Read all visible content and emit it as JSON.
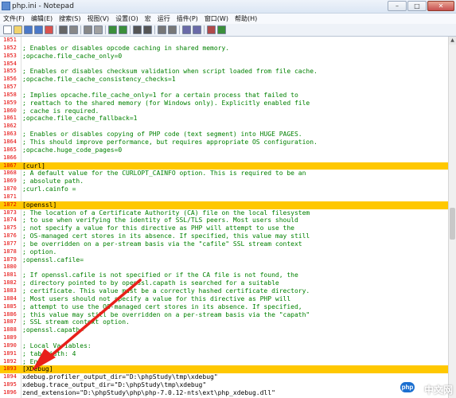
{
  "window": {
    "title": "php.ini - Notepad"
  },
  "menu": [
    "文件(F)",
    "编辑(E)",
    "搜索(S)",
    "视图(V)",
    "设置(O)",
    "宏",
    "运行",
    "插件(P)",
    "窗口(W)",
    "帮助(H)"
  ],
  "toolbar_icons": [
    "new-file-icon",
    "open-file-icon",
    "save-icon",
    "save-all-icon",
    "close-file-icon",
    "print-icon",
    "cut-icon",
    "copy-icon",
    "paste-icon",
    "undo-icon",
    "redo-icon",
    "find-icon",
    "replace-icon",
    "zoom-in-icon",
    "zoom-out-icon",
    "word-wrap-icon",
    "indent-icon",
    "macro-icon",
    "play-icon"
  ],
  "colors": {
    "highlight": "#ffc800",
    "comment": "#008000",
    "line_number": "#e40000",
    "arrow": "#e8201a"
  },
  "arrow_label": "",
  "editor": {
    "lines": [
      {
        "n": "1851",
        "text": "",
        "kind": "plain"
      },
      {
        "n": "1852",
        "text": "; Enables or disables opcode caching in shared memory.",
        "kind": "comment"
      },
      {
        "n": "1853",
        "text": ";opcache.file_cache_only=0",
        "kind": "comment"
      },
      {
        "n": "1854",
        "text": "",
        "kind": "plain"
      },
      {
        "n": "1855",
        "text": "; Enables or disables checksum validation when script loaded from file cache.",
        "kind": "comment"
      },
      {
        "n": "1856",
        "text": ";opcache.file_cache_consistency_checks=1",
        "kind": "comment"
      },
      {
        "n": "1857",
        "text": "",
        "kind": "plain"
      },
      {
        "n": "1858",
        "text": "; Implies opcache.file_cache_only=1 for a certain process that failed to",
        "kind": "comment"
      },
      {
        "n": "1859",
        "text": "; reattach to the shared memory (for Windows only). Explicitly enabled file",
        "kind": "comment"
      },
      {
        "n": "1860",
        "text": "; cache is required.",
        "kind": "comment"
      },
      {
        "n": "1861",
        "text": ";opcache.file_cache_fallback=1",
        "kind": "comment"
      },
      {
        "n": "1862",
        "text": "",
        "kind": "plain"
      },
      {
        "n": "1863",
        "text": "; Enables or disables copying of PHP code (text segment) into HUGE PAGES.",
        "kind": "comment"
      },
      {
        "n": "1864",
        "text": "; This should improve performance, but requires appropriate OS configuration.",
        "kind": "comment"
      },
      {
        "n": "1865",
        "text": ";opcache.huge_code_pages=0",
        "kind": "comment"
      },
      {
        "n": "1866",
        "text": "",
        "kind": "plain"
      },
      {
        "n": "1867",
        "text": "[curl]",
        "kind": "section"
      },
      {
        "n": "1868",
        "text": "; A default value for the CURLOPT_CAINFO option. This is required to be an",
        "kind": "comment"
      },
      {
        "n": "1869",
        "text": "; absolute path.",
        "kind": "comment"
      },
      {
        "n": "1870",
        "text": ";curl.cainfo =",
        "kind": "comment"
      },
      {
        "n": "1871",
        "text": "",
        "kind": "plain"
      },
      {
        "n": "1872",
        "text": "[openssl]",
        "kind": "section"
      },
      {
        "n": "1873",
        "text": "; The location of a Certificate Authority (CA) file on the local filesystem",
        "kind": "comment"
      },
      {
        "n": "1874",
        "text": "; to use when verifying the identity of SSL/TLS peers. Most users should",
        "kind": "comment"
      },
      {
        "n": "1875",
        "text": "; not specify a value for this directive as PHP will attempt to use the",
        "kind": "comment"
      },
      {
        "n": "1876",
        "text": "; OS-managed cert stores in its absence. If specified, this value may still",
        "kind": "comment"
      },
      {
        "n": "1877",
        "text": "; be overridden on a per-stream basis via the \"cafile\" SSL stream context",
        "kind": "comment"
      },
      {
        "n": "1878",
        "text": "; option.",
        "kind": "comment"
      },
      {
        "n": "1879",
        "text": ";openssl.cafile=",
        "kind": "comment"
      },
      {
        "n": "1880",
        "text": "",
        "kind": "plain"
      },
      {
        "n": "1881",
        "text": "; If openssl.cafile is not specified or if the CA file is not found, the",
        "kind": "comment"
      },
      {
        "n": "1882",
        "text": "; directory pointed to by openssl.capath is searched for a suitable",
        "kind": "comment"
      },
      {
        "n": "1883",
        "text": "; certificate. This value must be a correctly hashed certificate directory.",
        "kind": "comment"
      },
      {
        "n": "1884",
        "text": "; Most users should not specify a value for this directive as PHP will",
        "kind": "comment"
      },
      {
        "n": "1885",
        "text": "; attempt to use the OS-managed cert stores in its absence. If specified,",
        "kind": "comment"
      },
      {
        "n": "1886",
        "text": "; this value may still be overridden on a per-stream basis via the \"capath\"",
        "kind": "comment"
      },
      {
        "n": "1887",
        "text": "; SSL stream context option.",
        "kind": "comment"
      },
      {
        "n": "1888",
        "text": ";openssl.capath=",
        "kind": "comment"
      },
      {
        "n": "1889",
        "text": "",
        "kind": "plain"
      },
      {
        "n": "1890",
        "text": "; Local Variables:",
        "kind": "comment"
      },
      {
        "n": "1891",
        "text": "; tab-width: 4",
        "kind": "comment"
      },
      {
        "n": "1892",
        "text": "; End:",
        "kind": "comment"
      },
      {
        "n": "1893",
        "text": "[XDebug]",
        "kind": "section"
      },
      {
        "n": "1894",
        "text": "xdebug.profiler_output_dir=\"D:\\phpStudy\\tmp\\xdebug\"",
        "kind": "plain"
      },
      {
        "n": "1895",
        "text": "xdebug.trace_output_dir=\"D:\\phpStudy\\tmp\\xdebug\"",
        "kind": "plain"
      },
      {
        "n": "1896",
        "text": "zend_extension=\"D:\\phpStudy\\php\\php-7.0.12-nts\\ext\\php_xdebug.dll\"",
        "kind": "plain"
      }
    ]
  },
  "watermark": {
    "logo": "php",
    "text": "中文网"
  }
}
